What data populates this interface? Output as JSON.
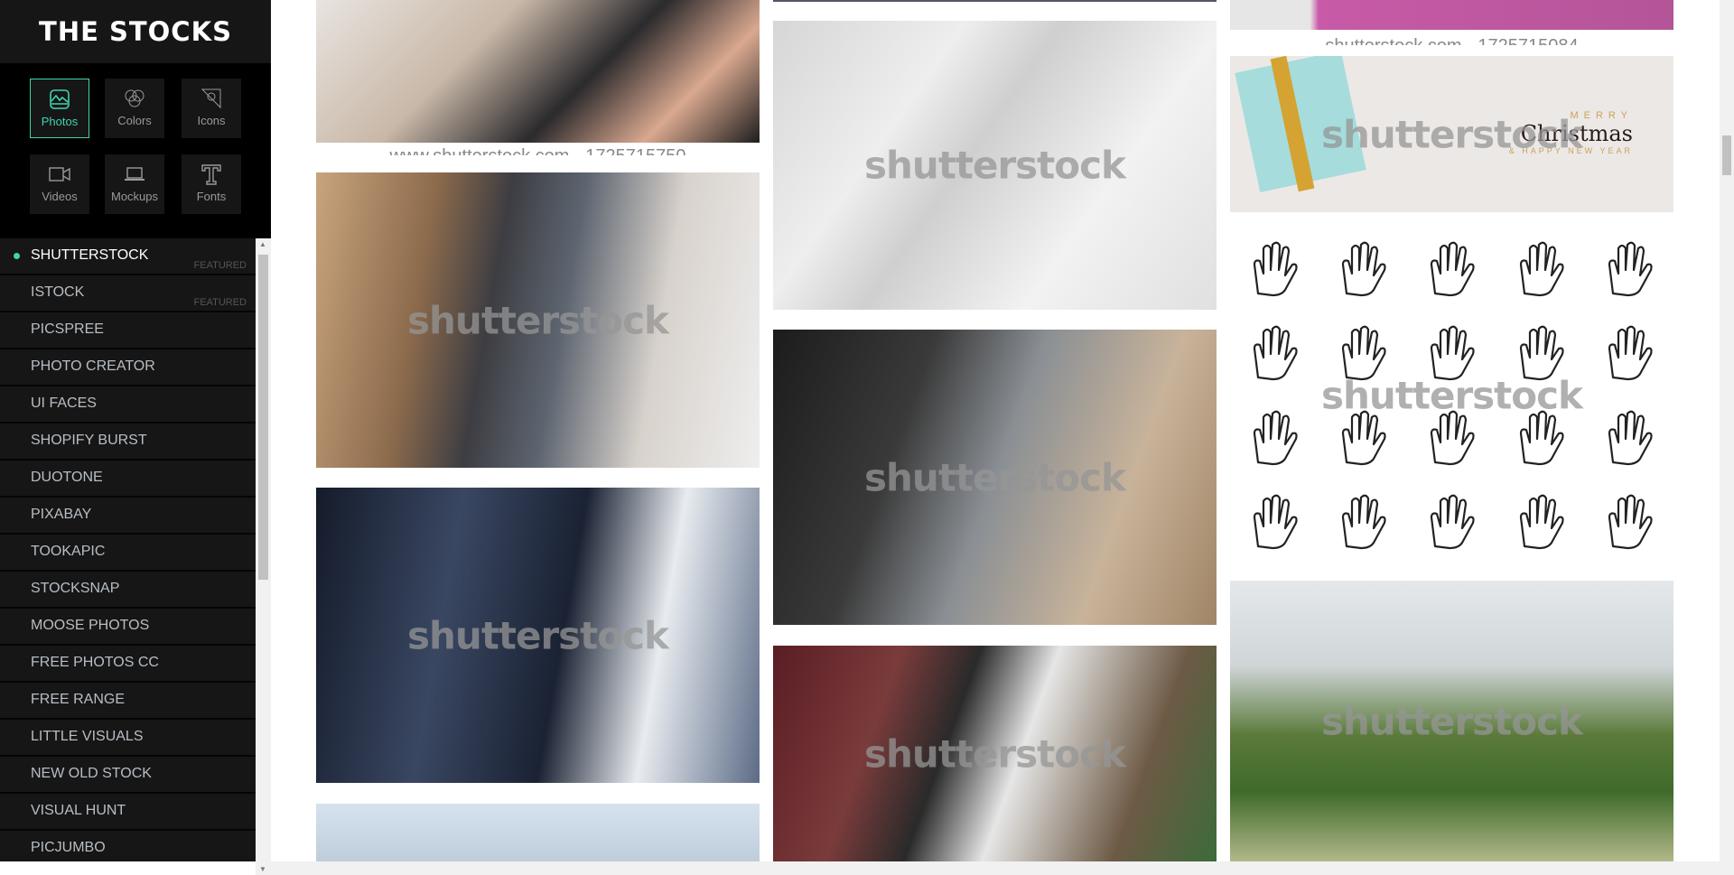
{
  "brand": {
    "title": "THE STOCKS",
    "accent": "#3fd4b0"
  },
  "categories": [
    {
      "label": "Photos",
      "icon": "photo-icon",
      "active": true
    },
    {
      "label": "Colors",
      "icon": "colors-icon"
    },
    {
      "label": "Icons",
      "icon": "icons-icon"
    },
    {
      "label": "Videos",
      "icon": "video-camera-icon"
    },
    {
      "label": "Mockups",
      "icon": "laptop-icon"
    },
    {
      "label": "Fonts",
      "icon": "font-icon"
    }
  ],
  "sources": [
    {
      "label": "SHUTTERSTOCK",
      "badge": "FEATURED",
      "active": true
    },
    {
      "label": "ISTOCK",
      "badge": "FEATURED"
    },
    {
      "label": "PICSPREE"
    },
    {
      "label": "PHOTO CREATOR"
    },
    {
      "label": "UI FACES"
    },
    {
      "label": "SHOPIFY BURST"
    },
    {
      "label": "DUOTONE"
    },
    {
      "label": "PIXABAY"
    },
    {
      "label": "TOOKAPIC"
    },
    {
      "label": "STOCKSNAP"
    },
    {
      "label": "MOOSE PHOTOS"
    },
    {
      "label": "FREE PHOTOS CC"
    },
    {
      "label": "FREE RANGE"
    },
    {
      "label": "LITTLE VISUALS"
    },
    {
      "label": "NEW OLD STOCK"
    },
    {
      "label": "VISUAL HUNT"
    },
    {
      "label": "PICJUMBO"
    }
  ],
  "gallery": {
    "watermark": "shutterstock",
    "captions": [
      "www.shutterstock.com · 1725715750",
      "shutterstock.com · 1725715084"
    ],
    "banner": {
      "top": "MERRY",
      "main": "Christmas",
      "sub": "& HAPPY NEW YEAR"
    }
  }
}
